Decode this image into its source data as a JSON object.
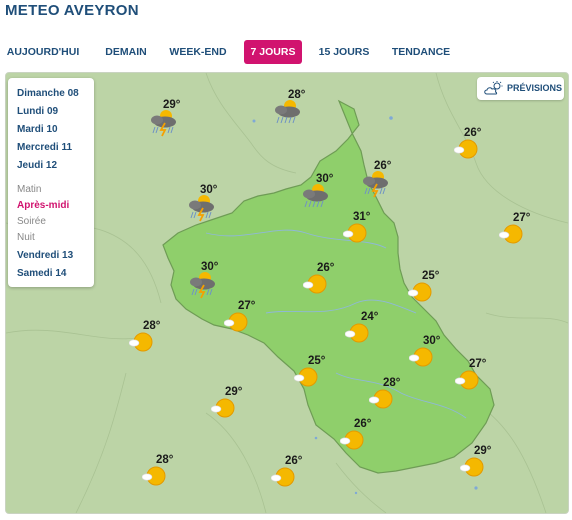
{
  "header": {
    "title": "METEO AVEYRON"
  },
  "tabs": [
    {
      "label": "AUJOURD'HUI",
      "active": false
    },
    {
      "label": "DEMAIN",
      "active": false
    },
    {
      "label": "WEEK-END",
      "active": false
    },
    {
      "label": "7 JOURS",
      "active": true
    },
    {
      "label": "15 JOURS",
      "active": false
    },
    {
      "label": "TENDANCE",
      "active": false
    }
  ],
  "days_before": [
    "Dimanche 08",
    "Lundi 09",
    "Mardi 10",
    "Mercredi 11",
    "Jeudi 12"
  ],
  "periods": [
    {
      "label": "Matin",
      "active": false
    },
    {
      "label": "Après-midi",
      "active": true
    },
    {
      "label": "Soirée",
      "active": false
    },
    {
      "label": "Nuit",
      "active": false
    }
  ],
  "days_after": [
    "Vendredi 13",
    "Samedi 14"
  ],
  "previsions_button": {
    "label": "PRÉVISIONS",
    "icon": "cloud-sun-icon"
  },
  "colors": {
    "accent": "#d1136f",
    "brand": "#1f4e79",
    "department": "#8fcf6b",
    "surroundings": "#bcd4a6"
  },
  "stations": [
    {
      "temp": "29°",
      "icon": "storm"
    },
    {
      "temp": "28°",
      "icon": "storm"
    },
    {
      "temp": "26°",
      "icon": "sun"
    },
    {
      "temp": "26°",
      "icon": "storm"
    },
    {
      "temp": "30°",
      "icon": "storm"
    },
    {
      "temp": "30°",
      "icon": "storm"
    },
    {
      "temp": "31°",
      "icon": "sun"
    },
    {
      "temp": "27°",
      "icon": "sun"
    },
    {
      "temp": "30°",
      "icon": "storm"
    },
    {
      "temp": "26°",
      "icon": "sun"
    },
    {
      "temp": "25°",
      "icon": "sun"
    },
    {
      "temp": "27°",
      "icon": "sun"
    },
    {
      "temp": "28°",
      "icon": "sun"
    },
    {
      "temp": "24°",
      "icon": "sun"
    },
    {
      "temp": "30°",
      "icon": "sun"
    },
    {
      "temp": "25°",
      "icon": "sun"
    },
    {
      "temp": "27°",
      "icon": "sun"
    },
    {
      "temp": "29°",
      "icon": "sun"
    },
    {
      "temp": "28°",
      "icon": "sun"
    },
    {
      "temp": "26°",
      "icon": "sun"
    },
    {
      "temp": "28°",
      "icon": "sun"
    },
    {
      "temp": "26°",
      "icon": "sun"
    },
    {
      "temp": "29°",
      "icon": "sun"
    }
  ]
}
